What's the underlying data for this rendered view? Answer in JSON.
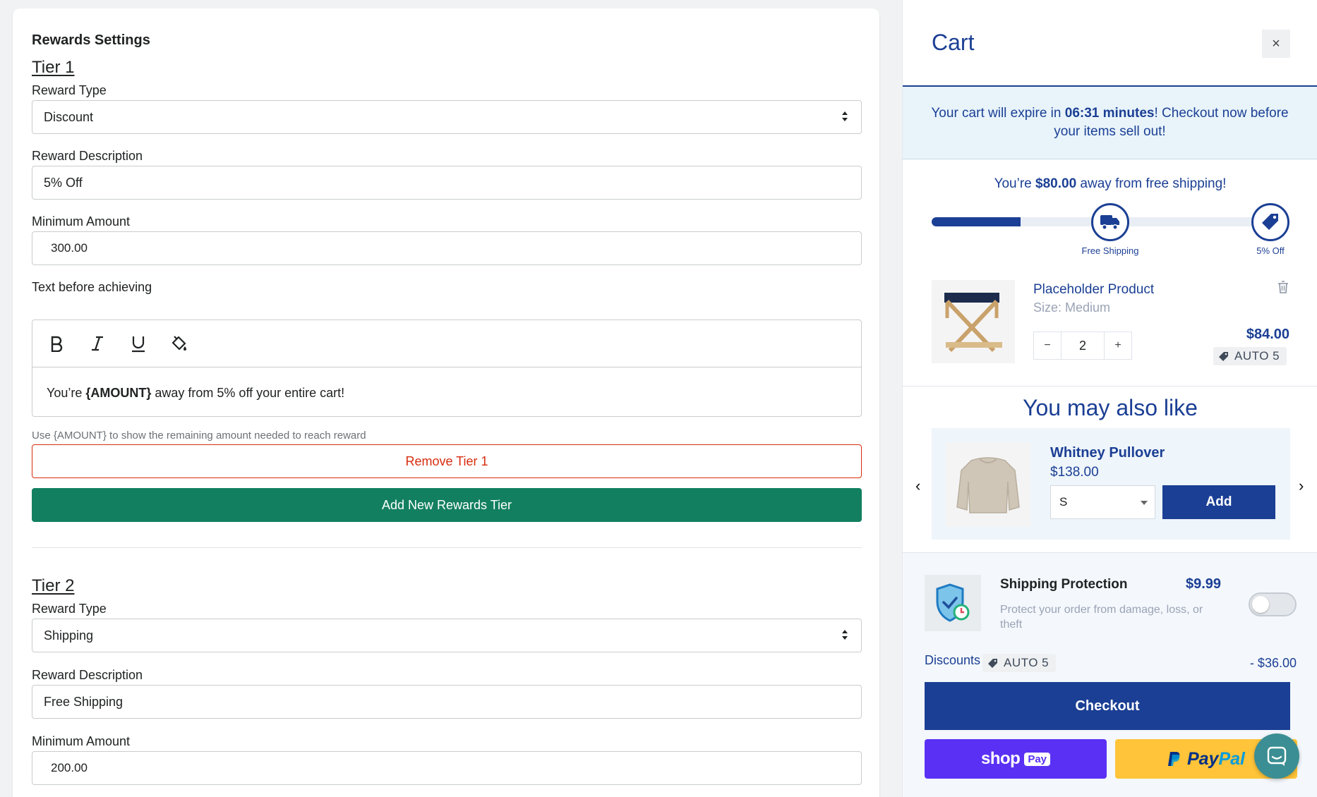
{
  "settings": {
    "title": "Rewards Settings",
    "tier1": {
      "title": "Tier 1",
      "reward_type_label": "Reward Type",
      "reward_type_value": "Discount",
      "reward_desc_label": "Reward Description",
      "reward_desc_value": "5% Off",
      "min_amount_label": "Minimum Amount",
      "min_amount_value": "300.00",
      "text_before_label": "Text before achieving",
      "editor_text_prefix": "You’re ",
      "editor_text_token": "{AMOUNT}",
      "editor_text_suffix": " away from 5% off your entire cart!",
      "help_text": "Use {AMOUNT} to show the remaining amount needed to reach reward",
      "remove_label": "Remove Tier 1"
    },
    "add_tier_label": "Add New Rewards Tier",
    "tier2": {
      "title": "Tier 2",
      "reward_type_label": "Reward Type",
      "reward_type_value": "Shipping",
      "reward_desc_label": "Reward Description",
      "reward_desc_value": "Free Shipping",
      "min_amount_label": "Minimum Amount",
      "min_amount_value": "200.00"
    }
  },
  "cart": {
    "title": "Cart",
    "close_icon": "×",
    "expire_prefix": "Your cart will expire in ",
    "expire_time": "06:31 minutes",
    "expire_suffix": "! Checkout now before your items sell out!",
    "ship_prefix": "You’re ",
    "ship_amount": "$80.00",
    "ship_suffix": " away from free shipping!",
    "progress_fraction": 0.25,
    "milestones": [
      {
        "label": "Free Shipping",
        "icon": "truck-icon"
      },
      {
        "label": "5% Off",
        "icon": "tag-icon"
      }
    ],
    "item": {
      "name": "Placeholder Product",
      "size": "Size: Medium",
      "quantity": "2",
      "minus": "−",
      "plus": "+",
      "price": "$84.00",
      "discount_code": "AUTO 5"
    },
    "upsell": {
      "title": "You may also like",
      "name": "Whitney Pullover",
      "price": "$138.00",
      "size_value": "S",
      "add_label": "Add",
      "prev": "‹",
      "next": "›"
    },
    "protection": {
      "title": "Shipping Protection",
      "price": "$9.99",
      "description": "Protect your order from damage, loss, or theft",
      "enabled": false
    },
    "discounts": {
      "label": "Discounts",
      "code": "AUTO 5",
      "amount": "- $36.00"
    },
    "checkout_label": "Checkout",
    "shoppay": {
      "word": "shop",
      "pay": "Pay"
    },
    "paypal": {
      "word_a": "Pay",
      "word_b": "Pal"
    }
  },
  "colors": {
    "brand_blue": "#1b3f94",
    "green_button": "#128060",
    "danger": "#d72c0d",
    "shoppay": "#5a31f4",
    "paypal": "#ffc439",
    "chat": "#3b8e93"
  }
}
